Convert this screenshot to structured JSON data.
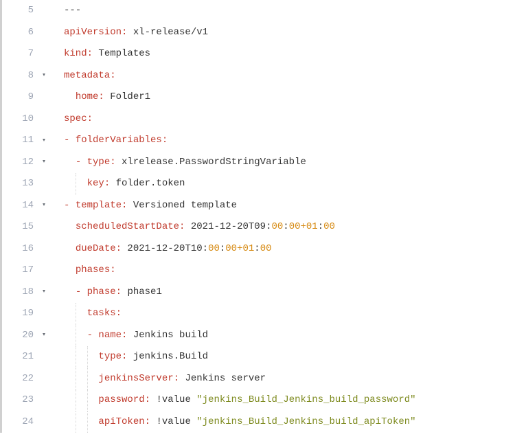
{
  "lines": [
    {
      "n": 5,
      "fold": "",
      "guides": [],
      "tokens": [
        {
          "c": "scalar",
          "t": "---"
        }
      ]
    },
    {
      "n": 6,
      "fold": "",
      "guides": [],
      "tokens": [
        {
          "c": "key",
          "t": "apiVersion:"
        },
        {
          "c": "scalar",
          "t": " xl-release/v1"
        }
      ]
    },
    {
      "n": 7,
      "fold": "",
      "guides": [],
      "tokens": [
        {
          "c": "key",
          "t": "kind:"
        },
        {
          "c": "scalar",
          "t": " Templates"
        }
      ]
    },
    {
      "n": 8,
      "fold": "▾",
      "guides": [],
      "tokens": [
        {
          "c": "key",
          "t": "metadata:"
        }
      ]
    },
    {
      "n": 9,
      "fold": "",
      "guides": [],
      "tokens": [
        {
          "c": "scalar",
          "t": "  "
        },
        {
          "c": "key",
          "t": "home:"
        },
        {
          "c": "scalar",
          "t": " Folder1"
        }
      ]
    },
    {
      "n": 10,
      "fold": "",
      "guides": [],
      "tokens": [
        {
          "c": "key",
          "t": "spec:"
        }
      ]
    },
    {
      "n": 11,
      "fold": "▾",
      "guides": [],
      "tokens": [
        {
          "c": "dash",
          "t": "- "
        },
        {
          "c": "key",
          "t": "folderVariables:"
        }
      ]
    },
    {
      "n": 12,
      "fold": "▾",
      "guides": [],
      "tokens": [
        {
          "c": "scalar",
          "t": "  "
        },
        {
          "c": "dash",
          "t": "- "
        },
        {
          "c": "key",
          "t": "type:"
        },
        {
          "c": "scalar",
          "t": " xlrelease.PasswordStringVariable"
        }
      ]
    },
    {
      "n": 13,
      "fold": "",
      "guides": [
        2
      ],
      "tokens": [
        {
          "c": "scalar",
          "t": "    "
        },
        {
          "c": "key",
          "t": "key:"
        },
        {
          "c": "scalar",
          "t": " folder.token"
        }
      ]
    },
    {
      "n": 14,
      "fold": "▾",
      "guides": [],
      "tokens": [
        {
          "c": "dash",
          "t": "- "
        },
        {
          "c": "key",
          "t": "template:"
        },
        {
          "c": "scalar",
          "t": " Versioned template"
        }
      ]
    },
    {
      "n": 15,
      "fold": "",
      "guides": [],
      "tokens": [
        {
          "c": "scalar",
          "t": "  "
        },
        {
          "c": "key",
          "t": "scheduledStartDate:"
        },
        {
          "c": "scalar",
          "t": " 2021-12-20T09:"
        },
        {
          "c": "num",
          "t": "00"
        },
        {
          "c": "scalar",
          "t": ":"
        },
        {
          "c": "num",
          "t": "00+01"
        },
        {
          "c": "scalar",
          "t": ":"
        },
        {
          "c": "num",
          "t": "00"
        }
      ]
    },
    {
      "n": 16,
      "fold": "",
      "guides": [],
      "tokens": [
        {
          "c": "scalar",
          "t": "  "
        },
        {
          "c": "key",
          "t": "dueDate:"
        },
        {
          "c": "scalar",
          "t": " 2021-12-20T10:"
        },
        {
          "c": "num",
          "t": "00"
        },
        {
          "c": "scalar",
          "t": ":"
        },
        {
          "c": "num",
          "t": "00+01"
        },
        {
          "c": "scalar",
          "t": ":"
        },
        {
          "c": "num",
          "t": "00"
        }
      ]
    },
    {
      "n": 17,
      "fold": "",
      "guides": [],
      "tokens": [
        {
          "c": "scalar",
          "t": "  "
        },
        {
          "c": "key",
          "t": "phases:"
        }
      ]
    },
    {
      "n": 18,
      "fold": "▾",
      "guides": [],
      "tokens": [
        {
          "c": "scalar",
          "t": "  "
        },
        {
          "c": "dash",
          "t": "- "
        },
        {
          "c": "key",
          "t": "phase:"
        },
        {
          "c": "scalar",
          "t": " phase1"
        }
      ]
    },
    {
      "n": 19,
      "fold": "",
      "guides": [
        2
      ],
      "tokens": [
        {
          "c": "scalar",
          "t": "    "
        },
        {
          "c": "key",
          "t": "tasks:"
        }
      ]
    },
    {
      "n": 20,
      "fold": "▾",
      "guides": [
        2
      ],
      "tokens": [
        {
          "c": "scalar",
          "t": "    "
        },
        {
          "c": "dash",
          "t": "- "
        },
        {
          "c": "key",
          "t": "name:"
        },
        {
          "c": "scalar",
          "t": " Jenkins build"
        }
      ]
    },
    {
      "n": 21,
      "fold": "",
      "guides": [
        2,
        4
      ],
      "tokens": [
        {
          "c": "scalar",
          "t": "      "
        },
        {
          "c": "key",
          "t": "type:"
        },
        {
          "c": "scalar",
          "t": " jenkins.Build"
        }
      ]
    },
    {
      "n": 22,
      "fold": "",
      "guides": [
        2,
        4
      ],
      "tokens": [
        {
          "c": "scalar",
          "t": "      "
        },
        {
          "c": "key",
          "t": "jenkinsServer:"
        },
        {
          "c": "scalar",
          "t": " Jenkins server"
        }
      ]
    },
    {
      "n": 23,
      "fold": "",
      "guides": [
        2,
        4
      ],
      "tokens": [
        {
          "c": "scalar",
          "t": "      "
        },
        {
          "c": "key",
          "t": "password:"
        },
        {
          "c": "tag",
          "t": " !value "
        },
        {
          "c": "str",
          "t": "\"jenkins_Build_Jenkins_build_password\""
        }
      ]
    },
    {
      "n": 24,
      "fold": "",
      "guides": [
        2,
        4
      ],
      "tokens": [
        {
          "c": "scalar",
          "t": "      "
        },
        {
          "c": "key",
          "t": "apiToken:"
        },
        {
          "c": "tag",
          "t": " !value "
        },
        {
          "c": "str",
          "t": "\"jenkins_Build_Jenkins_build_apiToken\""
        }
      ]
    }
  ]
}
